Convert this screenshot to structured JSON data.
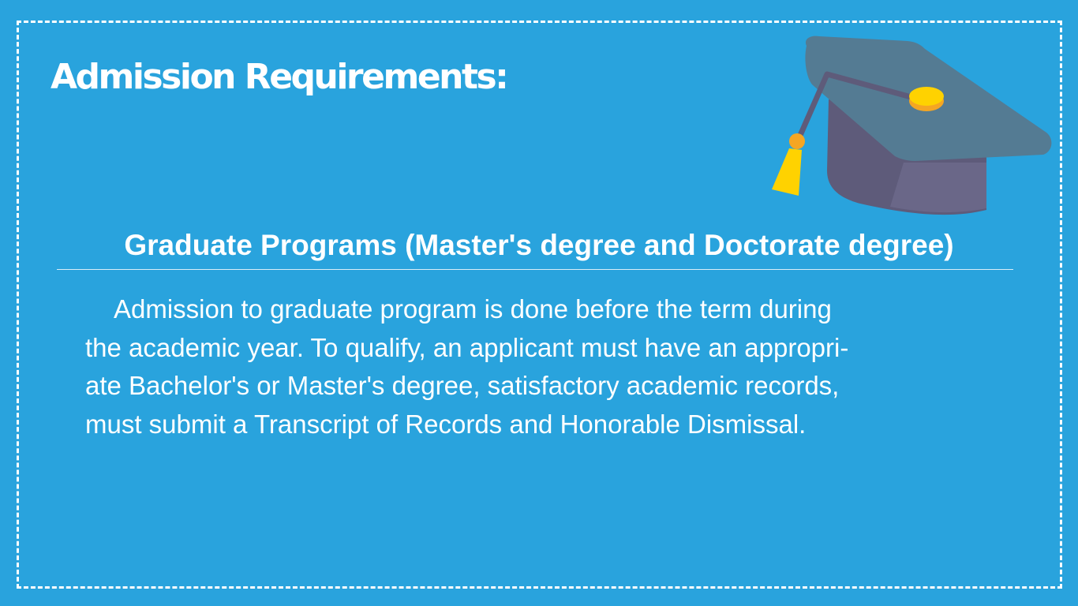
{
  "slide": {
    "title": "Admission Requirements:",
    "subtitle": "Graduate Programs (Master's degree and Doctorate degree)",
    "body_lines": [
      "Admission to graduate program is done before the term during",
      "the academic year. To qualify, an applicant must have an appropri-",
      "ate Bachelor's or Master's degree, satisfactory academic records,",
      "must submit a Transcript of Records and Honorable Dismissal."
    ],
    "icon": "graduation-cap-icon"
  },
  "colors": {
    "background": "#29a3dd",
    "text": "#ffffff",
    "cap_board": "#547b93",
    "cap_base": "#5e5b7a",
    "tassel": "#ffd200",
    "button": "#f5a623"
  }
}
